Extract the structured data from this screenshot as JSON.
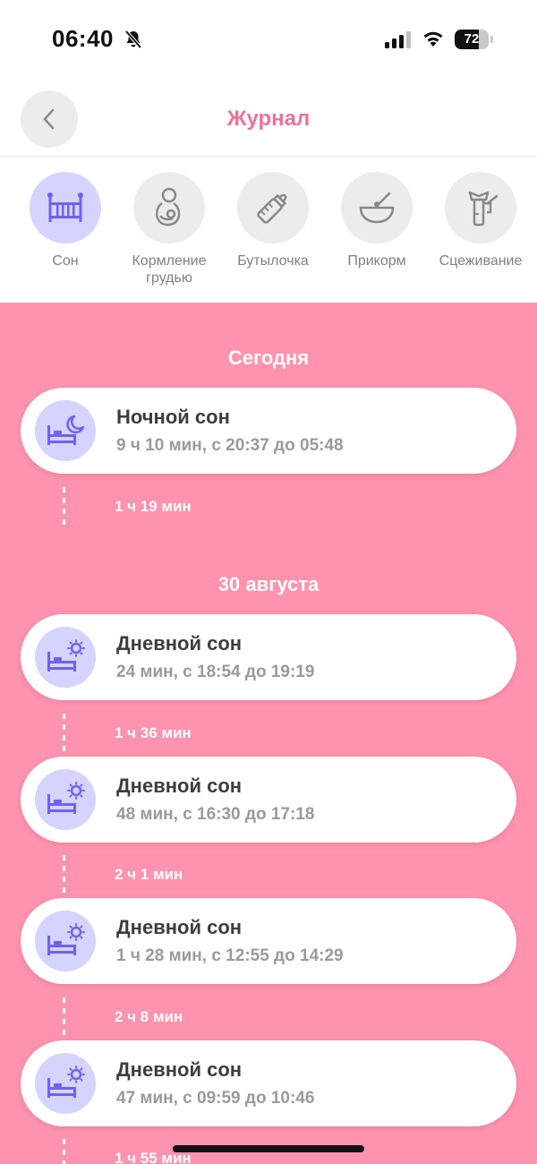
{
  "status_bar": {
    "time": "06:40",
    "battery_level": "72",
    "battery_fraction": 0.72
  },
  "header": {
    "title": "Журнал"
  },
  "categories": [
    {
      "label": "Сон",
      "icon": "crib-icon",
      "active": true
    },
    {
      "label": "Кормление грудью",
      "icon": "breastfeeding-icon",
      "active": false
    },
    {
      "label": "Бутылочка",
      "icon": "bottle-icon",
      "active": false
    },
    {
      "label": "Прикорм",
      "icon": "bowl-icon",
      "active": false
    },
    {
      "label": "Сцеживание",
      "icon": "breast-pump-icon",
      "active": false
    }
  ],
  "sections": [
    {
      "date": "Сегодня",
      "entries": [
        {
          "title": "Ночной сон",
          "subtitle": "9 ч 10 мин, с 20:37 до 05:48",
          "icon": "night-sleep-icon",
          "gap_after": "1 ч 19 мин"
        }
      ]
    },
    {
      "date": "30 августа",
      "entries": [
        {
          "title": "Дневной сон",
          "subtitle": "24 мин, с 18:54 до 19:19",
          "icon": "day-sleep-icon",
          "gap_after": "1 ч 36 мин"
        },
        {
          "title": "Дневной сон",
          "subtitle": "48 мин, с 16:30 до 17:18",
          "icon": "day-sleep-icon",
          "gap_after": "2 ч 1 мин"
        },
        {
          "title": "Дневной сон",
          "subtitle": "1 ч 28 мин, с 12:55 до 14:29",
          "icon": "day-sleep-icon",
          "gap_after": "2 ч 8 мин"
        },
        {
          "title": "Дневной сон",
          "subtitle": "47 мин, с 09:59 до 10:46",
          "icon": "day-sleep-icon",
          "gap_after": "1 ч 55 мин"
        }
      ]
    }
  ],
  "colors": {
    "accent": "#f0709a",
    "background": "#fd93ae",
    "icon_bg": "#d5d3ff",
    "icon_fg": "#6e62f0"
  }
}
